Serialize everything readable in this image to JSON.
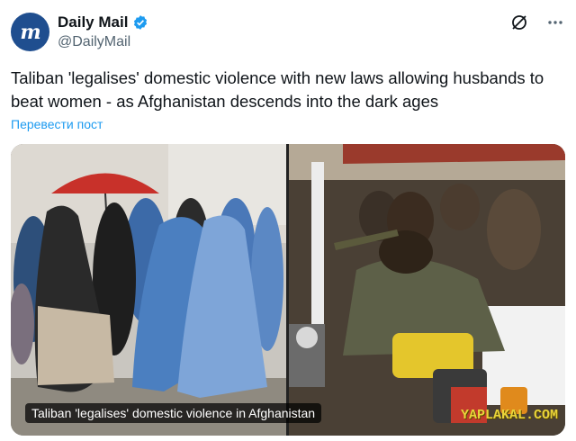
{
  "account": {
    "avatar_letter": "m",
    "name": "Daily Mail",
    "handle": "@DailyMail",
    "verified_color": "#1d9bf0",
    "avatar_color": "#1f4e8f"
  },
  "actions": {
    "grok_icon": "grok-icon",
    "more_icon": "more-dots-icon"
  },
  "tweet": {
    "text": "Taliban 'legalises' domestic violence with new laws allowing husbands to beat women - as Afghanistan descends into the dark ages",
    "translate_label": "Перевести пост"
  },
  "media": {
    "caption": "Taliban 'legalises' domestic violence in Afghanistan",
    "watermark": "YAPLAKAL.COM"
  }
}
